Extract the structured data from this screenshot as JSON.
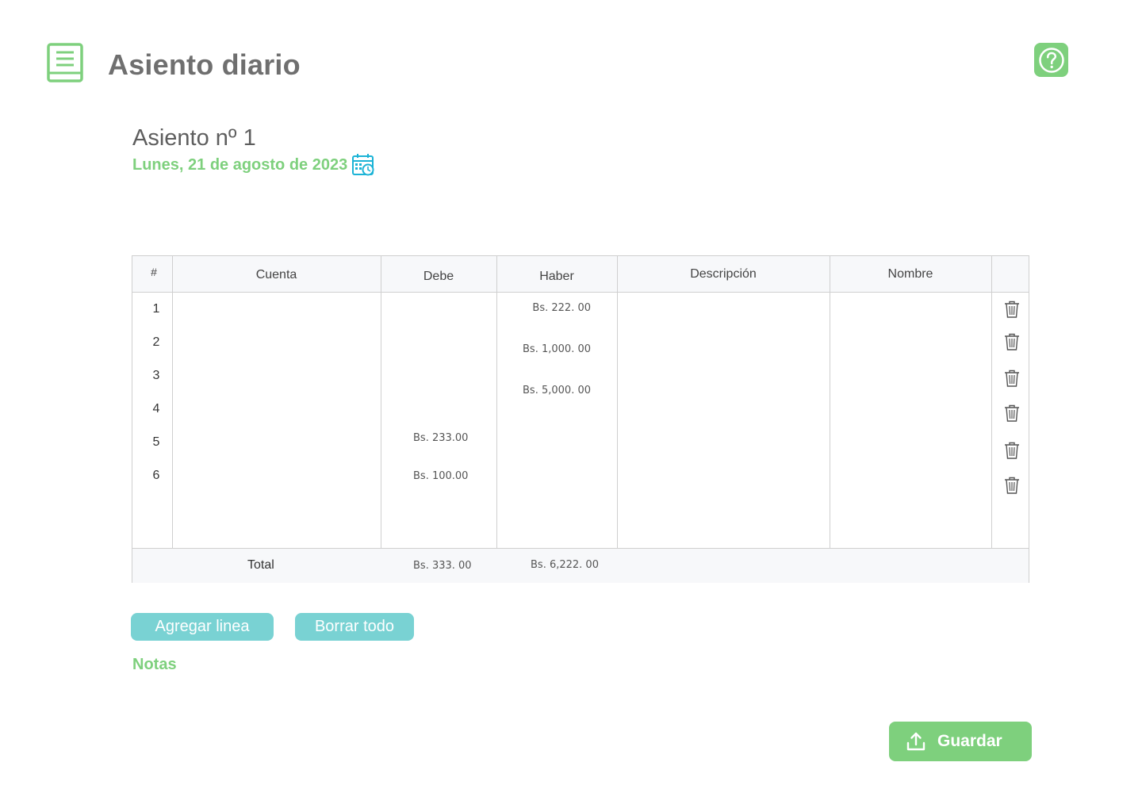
{
  "header": {
    "title": "Asiento diario",
    "app_icon": "book-icon",
    "help_icon": "question-circle-icon"
  },
  "entry": {
    "title": "Asiento nº 1",
    "date": "Lunes, 21 de agosto de 2023",
    "date_icon": "calendar-clock-icon"
  },
  "table": {
    "columns": [
      "#",
      "Cuenta",
      "Debe",
      "Haber",
      "Descripción",
      "Nombre"
    ],
    "rows": [
      {
        "num": "1",
        "cuenta": "",
        "debe": "",
        "haber": "Bs. 222. 00",
        "descripcion": "",
        "nombre": ""
      },
      {
        "num": "2",
        "cuenta": "",
        "debe": "",
        "haber": "Bs. 1,000. 00",
        "descripcion": "",
        "nombre": ""
      },
      {
        "num": "3",
        "cuenta": "",
        "debe": "",
        "haber": "Bs. 5,000. 00",
        "descripcion": "",
        "nombre": ""
      },
      {
        "num": "4",
        "cuenta": "",
        "debe": "",
        "haber": "",
        "descripcion": "",
        "nombre": ""
      },
      {
        "num": "5",
        "cuenta": "",
        "debe": "Bs. 233.00",
        "haber": "",
        "descripcion": "",
        "nombre": ""
      },
      {
        "num": "6",
        "cuenta": "",
        "debe": "Bs. 100.00",
        "haber": "",
        "descripcion": "",
        "nombre": ""
      }
    ],
    "delete_icon": "trash-icon",
    "total": {
      "label": "Total",
      "debe": "Bs. 333. 00",
      "haber": "Bs. 6,222. 00"
    }
  },
  "actions": {
    "add_line": "Agregar linea",
    "clear_all": "Borrar todo",
    "save": "Guardar",
    "save_icon": "upload-icon"
  },
  "notes": {
    "label": "Notas"
  },
  "colors": {
    "accent_green": "#7ed07d",
    "accent_teal": "#79d2d3",
    "title_gray": "#6f6f6f",
    "calendar_blue": "#1bb3d6"
  }
}
